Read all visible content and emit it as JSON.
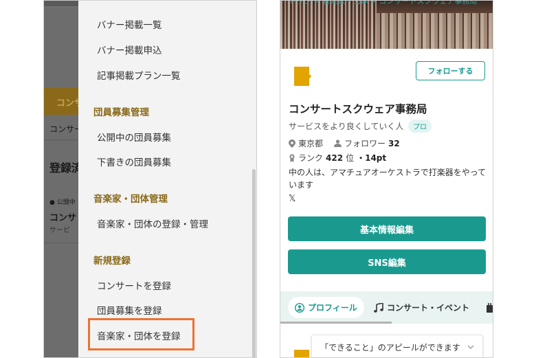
{
  "left": {
    "drawer_items": [
      {
        "label": "バナー掲載一覧"
      },
      {
        "label": "バナー掲載申込"
      },
      {
        "label": "記事掲載プラン一覧"
      }
    ],
    "sections": [
      {
        "title": "団員募集管理",
        "items": [
          "公開中の団員募集",
          "下書きの団員募集"
        ]
      },
      {
        "title": "音楽家・団体管理",
        "items": [
          "音楽家・団体の登録・管理"
        ]
      },
      {
        "title": "新規登録",
        "items": [
          "コンサートを登録",
          "団員募集を登録",
          "音楽家・団体を登録"
        ]
      }
    ],
    "dim_bg": {
      "concert_bar": "コンサ",
      "concert_label": "コンサー",
      "registered": "登録済",
      "status": "● 公開中",
      "card_title": "コンサ",
      "card_sub": "サービ"
    },
    "highlight_color": "#f07030"
  },
  "right": {
    "breadcrumb": "トップ > 音楽家・団体 > コンサートスクウェア事務局",
    "follow_label": "フォローする",
    "org_name": "コンサートスクウェア事務局",
    "tagline": "サービスをより良くしていく人",
    "pro_badge": "プロ",
    "location": "東京都",
    "followers_label": "フォロワー",
    "followers_count": "32",
    "rank_label": "ランク",
    "rank_value": "422",
    "rank_unit": "位",
    "points": "・14pt",
    "bio": "中の人は、アマチュアオーケストラで打楽器をやっています",
    "buttons": {
      "edit_basic": "基本情報編集",
      "edit_sns": "SNS編集"
    },
    "tabs": {
      "profile": "プロフィール",
      "concert": "コンサート・イベント"
    },
    "appeal_select": "「できること」のアピールができます",
    "accent": "#1a9a8f",
    "brand": "#e2a400"
  }
}
